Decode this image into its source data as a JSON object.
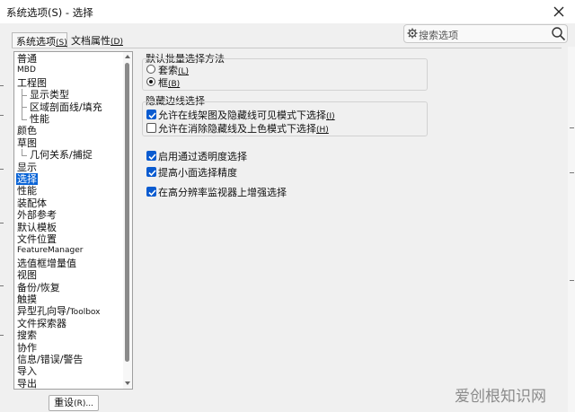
{
  "window": {
    "title": "系统选项(S) - 选择",
    "close_icon": "close-icon"
  },
  "tabs": [
    {
      "label": "系统选项",
      "accel": "(S)",
      "active": true
    },
    {
      "label": "文档属性",
      "accel": "(D)",
      "active": false
    }
  ],
  "search": {
    "placeholder": "搜索选项",
    "gear_icon": "gear-icon",
    "magnifier_icon": "search-icon"
  },
  "nav": {
    "items": [
      {
        "label": "普通",
        "indent": 0,
        "small": false
      },
      {
        "label": "MBD",
        "indent": 0,
        "small": true
      },
      {
        "label": "工程图",
        "indent": 0,
        "small": false
      },
      {
        "label": "显示类型",
        "indent": 1,
        "small": false
      },
      {
        "label": "区域剖面线/填充",
        "indent": 1,
        "small": false
      },
      {
        "label": "性能",
        "indent": 1,
        "small": false
      },
      {
        "label": "颜色",
        "indent": 0,
        "small": false
      },
      {
        "label": "草图",
        "indent": 0,
        "small": false
      },
      {
        "label": "几何关系/捕捉",
        "indent": 1,
        "small": false
      },
      {
        "label": "显示",
        "indent": 0,
        "small": false
      },
      {
        "label": "选择",
        "indent": 0,
        "small": false,
        "selected": true
      },
      {
        "label": "性能",
        "indent": 0,
        "small": false
      },
      {
        "label": "装配体",
        "indent": 0,
        "small": false
      },
      {
        "label": "外部参考",
        "indent": 0,
        "small": false
      },
      {
        "label": "默认模板",
        "indent": 0,
        "small": false
      },
      {
        "label": "文件位置",
        "indent": 0,
        "small": false
      },
      {
        "label": "FeatureManager",
        "indent": 0,
        "small": true
      },
      {
        "label": "选值框增量值",
        "indent": 0,
        "small": false
      },
      {
        "label": "视图",
        "indent": 0,
        "small": false
      },
      {
        "label": "备份/恢复",
        "indent": 0,
        "small": false
      },
      {
        "label": "触摸",
        "indent": 0,
        "small": false
      },
      {
        "label": "异型孔向导/",
        "suffix": "Toolbox",
        "indent": 0,
        "small": false
      },
      {
        "label": "文件探索器",
        "indent": 0,
        "small": false
      },
      {
        "label": "搜索",
        "indent": 0,
        "small": false
      },
      {
        "label": "协作",
        "indent": 0,
        "small": false
      },
      {
        "label": "信息/错误/警告",
        "indent": 0,
        "small": false
      },
      {
        "label": "导入",
        "indent": 0,
        "small": false
      },
      {
        "label": "导出",
        "indent": 0,
        "small": false
      }
    ]
  },
  "reset_button": {
    "label": "重设",
    "accel": "(R)..."
  },
  "batch_selection": {
    "title": "默认批量选择方法",
    "options": [
      {
        "label": "套索",
        "accel": "(L)",
        "selected": false
      },
      {
        "label": "框",
        "accel": "(B)",
        "selected": true
      }
    ]
  },
  "hidden_edges": {
    "title": "隐藏边线选择",
    "options": [
      {
        "label": "允许在线架图及隐藏线可见模式下选择",
        "accel": "(I)",
        "checked": true
      },
      {
        "label": "允许在消除隐藏线及上色模式下选择",
        "accel": "(H)",
        "checked": false
      }
    ]
  },
  "other_options": [
    {
      "label": "启用通过透明度选择",
      "checked": true
    },
    {
      "label": "提高小面选择精度",
      "checked": true
    },
    {
      "label": "在高分辨率监视器上增强选择",
      "checked": true
    }
  ],
  "watermark": {
    "text": "爱创根知识网"
  },
  "colors": {
    "accent": "#0a64d6",
    "checkbox": "#0a5bd0"
  }
}
